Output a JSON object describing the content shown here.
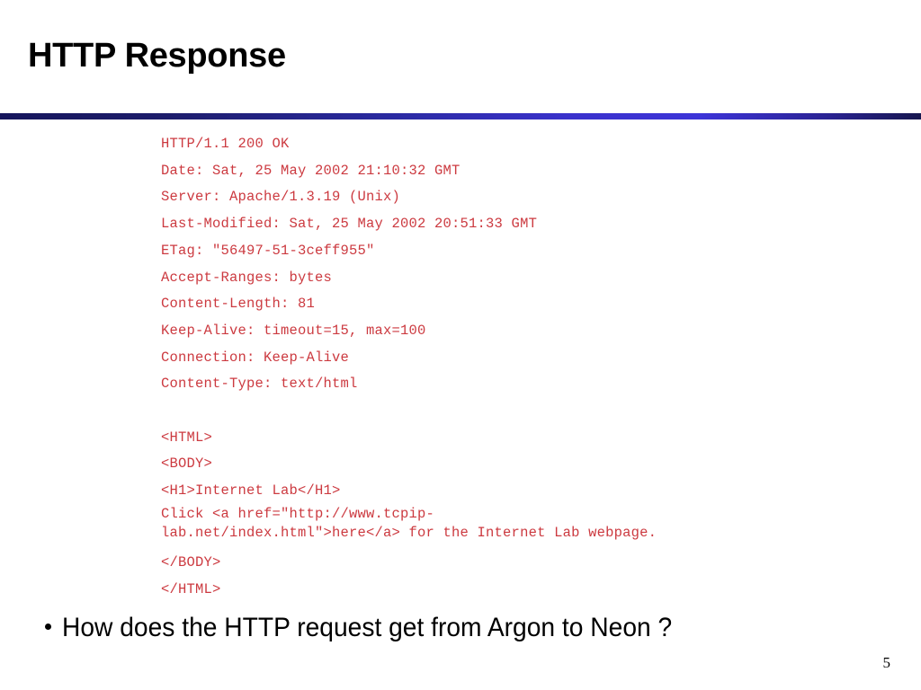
{
  "slide": {
    "title": "HTTP Response",
    "page_number": "5",
    "accent_color_dark": "#16165c",
    "accent_color_bright": "#3d34d8",
    "code_color": "#cc3a40",
    "text_color": "#000000",
    "background_color": "#ffffff"
  },
  "response": {
    "header_lines": [
      "HTTP/1.1 200 OK",
      "Date: Sat, 25 May 2002 21:10:32 GMT",
      "Server: Apache/1.3.19 (Unix)",
      "Last-Modified: Sat, 25 May 2002 20:51:33 GMT",
      "ETag: \"56497-51-3ceff955\"",
      "Accept-Ranges: bytes",
      "Content-Length: 81",
      "Keep-Alive: timeout=15, max=100",
      "Connection: Keep-Alive",
      "Content-Type: text/html"
    ],
    "body_lines": [
      "<HTML>",
      "<BODY>",
      "<H1>Internet Lab</H1>"
    ],
    "wrapped_line": {
      "first": "Click <a href=\"http://www.tcpip-",
      "second": "lab.net/index.html\">here</a> for the Internet Lab webpage."
    },
    "closing_lines": [
      "</BODY>",
      "</HTML>"
    ]
  },
  "bullet": {
    "marker": "•",
    "text": "How does the HTTP request get from Argon to Neon ?"
  }
}
